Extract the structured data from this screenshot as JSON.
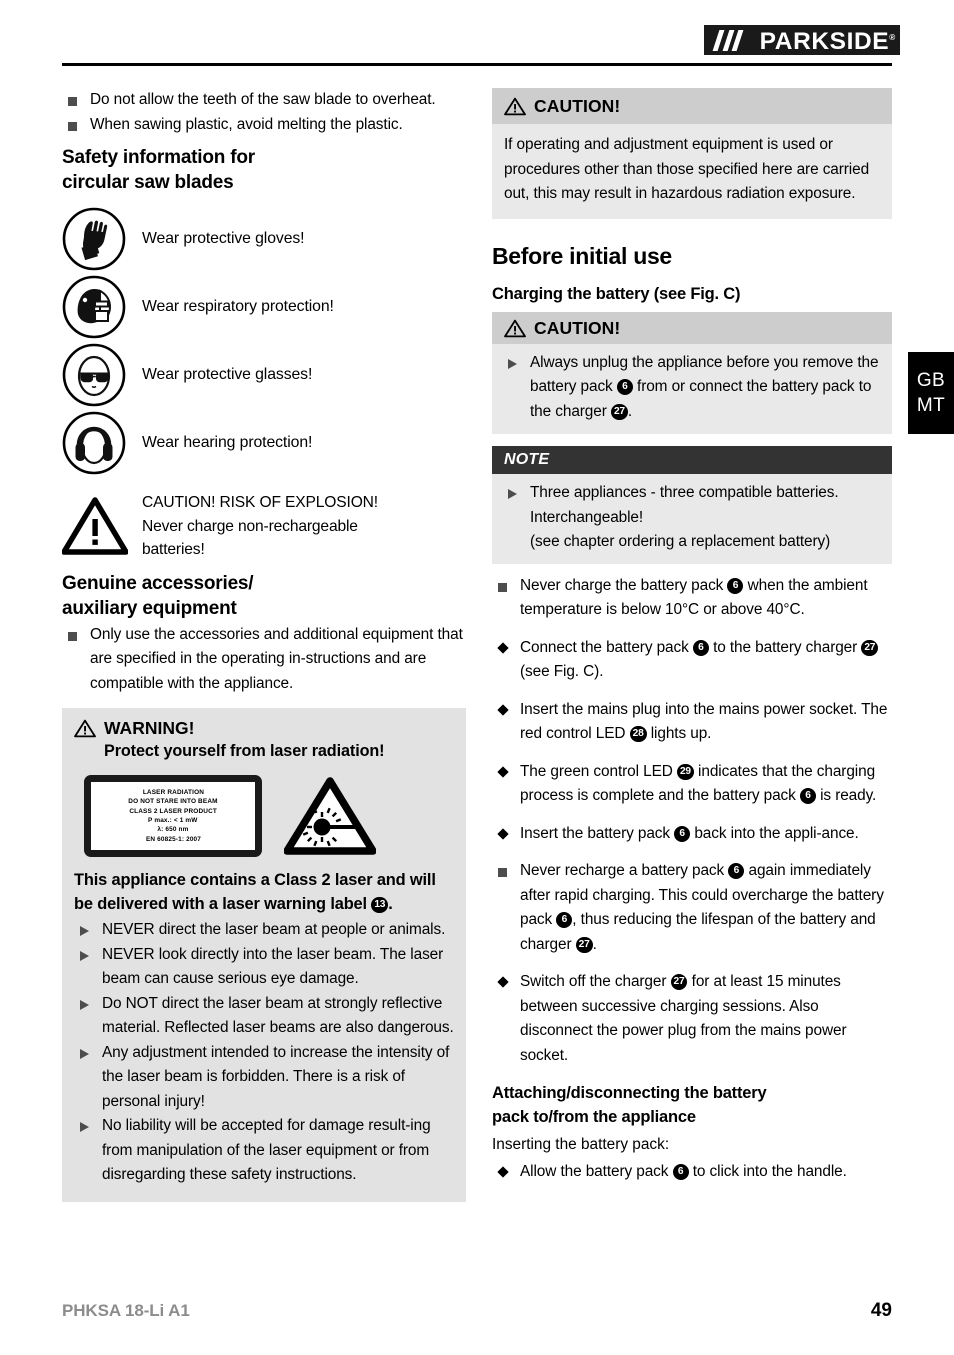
{
  "header": {
    "brand": "PARKSIDE",
    "brand_mark": "®"
  },
  "lang_tab": {
    "line1": "GB",
    "line2": "MT"
  },
  "footer": {
    "model": "PHKSA 18-Li A1",
    "page_number": "49"
  },
  "left_column": {
    "intro_bullets": [
      "Do not allow the teeth of the saw blade to overheat.",
      "When sawing plastic, avoid melting the plastic."
    ],
    "safety_heading_line1": "Safety information for",
    "safety_heading_line2": "circular saw blades",
    "pictograms": [
      {
        "icon": "protective-gloves-icon",
        "label": "Wear protective gloves!"
      },
      {
        "icon": "respiratory-protection-icon",
        "label": "Wear respiratory protection!"
      },
      {
        "icon": "protective-glasses-icon",
        "label": "Wear protective glasses!"
      },
      {
        "icon": "hearing-protection-icon",
        "label": "Wear hearing protection!"
      }
    ],
    "explosion_warning": {
      "icon": "warning-triangle-icon",
      "line1": "CAUTION! RISK OF EXPLOSION!",
      "line2": "Never charge non-rechargeable",
      "line3": "batteries!"
    },
    "accessories_heading_line1": "Genuine accessories/",
    "accessories_heading_line2": "auxiliary equipment",
    "accessories_bullet": "Only use the accessories and additional equipment that are specified in the operating in-structions and are compatible with the appliance.",
    "warning_box": {
      "icon": "warning-triangle-icon",
      "title": "WARNING!",
      "subtitle": "Protect yourself from laser radiation!",
      "laser_label_lines": [
        "LASER RADIATION",
        "DO NOT STARE INTO BEAM",
        "CLASS 2 LASER PRODUCT",
        "P max.: < 1 mW",
        "λ: 650 nm",
        "EN 60825-1: 2007"
      ],
      "laser_hazard_icon": "laser-beam-hazard-icon",
      "class2_note": "This appliance contains a Class 2 laser and will be delivered with a laser warning label",
      "class2_ref": "13",
      "bullets": [
        "NEVER direct the laser beam at people or animals.",
        "NEVER look directly into the laser beam. The laser beam can cause serious eye damage.",
        "Do NOT direct the laser beam at strongly reflective material. Reflected laser beams are also dangerous.",
        "Any adjustment intended to increase the intensity of the laser beam is forbidden. There is a risk of personal injury!",
        "No liability will be accepted for damage result-ing from manipulation of the laser equipment or from disregarding these safety instructions."
      ]
    }
  },
  "right_column": {
    "caution_top": {
      "icon": "warning-triangle-icon",
      "title": "CAUTION!",
      "text": "If operating and adjustment equipment is used or procedures other than those specified here are carried out, this may result in hazardous radiation exposure."
    },
    "chapter_title": "Before initial use",
    "charging_heading": "Charging the battery (see Fig. C)",
    "caution_charging": {
      "icon": "warning-triangle-icon",
      "title": "CAUTION!",
      "bullet_a": "Always unplug the appliance before you remove the battery pack",
      "ref_a1": "6",
      "bullet_b": "from or connect the battery pack to the charger",
      "ref_a2": "27",
      "bullet_c": "."
    },
    "note_box": {
      "title": "NOTE",
      "line1": "Three appliances - three compatible batteries.",
      "line2": "Interchangeable!",
      "line3": "(see chapter ordering a replacement battery)"
    },
    "items": [
      {
        "bullet": "square",
        "parts": [
          "Never charge the battery pack ",
          "6",
          " when the ambient temperature is below 10°C or above 40°C."
        ]
      },
      {
        "bullet": "diamond",
        "parts": [
          "Connect the battery pack ",
          "6",
          " to the battery charger ",
          "27",
          " (see Fig. C)."
        ]
      },
      {
        "bullet": "diamond",
        "parts": [
          "Insert the mains plug into the mains power socket. The red control LED ",
          "28",
          " lights up."
        ]
      },
      {
        "bullet": "diamond",
        "parts": [
          "The green control LED ",
          "29",
          " indicates that the charging process is complete and the battery pack ",
          "6",
          " is ready."
        ]
      },
      {
        "bullet": "diamond",
        "parts": [
          "Insert the battery pack ",
          "6",
          " back into the appli-ance."
        ]
      },
      {
        "bullet": "square",
        "parts": [
          "Never recharge a battery pack ",
          "6",
          " again immediately after rapid charging. This could overcharge the battery pack ",
          "6",
          ", thus reducing the lifespan of the battery and charger ",
          "27",
          "."
        ]
      },
      {
        "bullet": "diamond",
        "parts": [
          "Switch off the charger ",
          "27",
          " for at least 15 minutes between successive charging sessions. Also disconnect the power plug from the mains power socket."
        ]
      }
    ],
    "attach_heading_line1": "Attaching/disconnecting the battery",
    "attach_heading_line2": "pack to/from the appliance",
    "inserting_label": "Inserting the battery pack:",
    "inserting_bullet": {
      "parts": [
        "Allow the battery pack ",
        "6",
        " to click into the handle."
      ]
    }
  }
}
